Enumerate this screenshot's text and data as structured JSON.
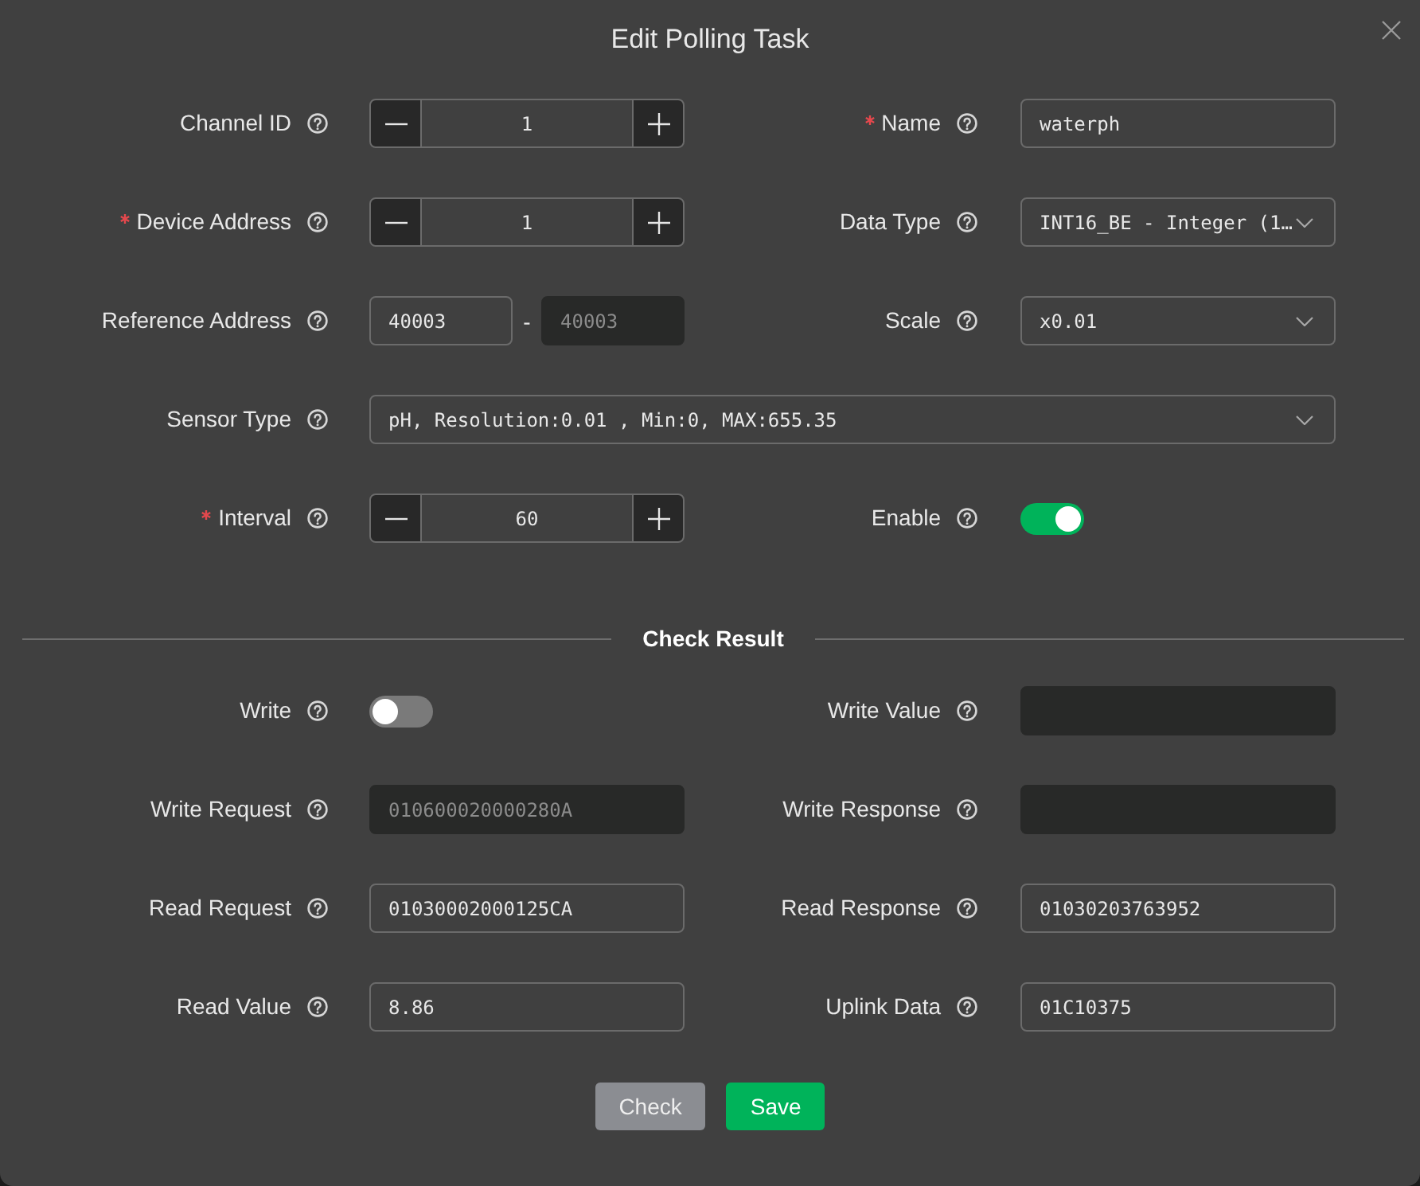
{
  "dialog": {
    "title": "Edit Polling Task"
  },
  "form": {
    "rows": [
      {
        "fields": [
          {
            "kind": "stepper",
            "label": "Channel ID",
            "required": false,
            "value": "1"
          },
          {
            "kind": "text",
            "label": "Name",
            "required": true,
            "value": "waterph",
            "disabled": false
          }
        ]
      },
      {
        "fields": [
          {
            "kind": "stepper",
            "label": "Device Address",
            "required": true,
            "value": "1"
          },
          {
            "kind": "select",
            "label": "Data Type",
            "required": false,
            "value": "INT16_BE - Integer (1…"
          }
        ]
      },
      {
        "fields": [
          {
            "kind": "range",
            "label": "Reference Address",
            "required": false,
            "from": {
              "value": "40003",
              "disabled": false
            },
            "separator": "-",
            "to": {
              "value": "40003",
              "disabled": true
            }
          },
          {
            "kind": "select",
            "label": "Scale",
            "required": false,
            "value": "x0.01"
          }
        ]
      },
      {
        "fields": [
          {
            "kind": "select",
            "label": "Sensor Type",
            "required": false,
            "value": "pH, Resolution:0.01 , Min:0, MAX:655.35"
          }
        ]
      },
      {
        "fields": [
          {
            "kind": "stepper",
            "label": "Interval",
            "required": true,
            "value": "60"
          },
          {
            "kind": "toggle",
            "label": "Enable",
            "required": false,
            "on": true
          }
        ]
      }
    ]
  },
  "check_result": {
    "title": "Check Result",
    "rows": [
      {
        "fields": [
          {
            "kind": "toggle",
            "label": "Write",
            "required": false,
            "on": false
          },
          {
            "kind": "text",
            "label": "Write Value",
            "required": false,
            "disabled": true
          }
        ]
      },
      {
        "fields": [
          {
            "kind": "text",
            "label": "Write Request",
            "required": false,
            "value": "010600020000280A",
            "disabled": true
          },
          {
            "kind": "text",
            "label": "Write Response",
            "required": false,
            "disabled": true
          }
        ]
      },
      {
        "fields": [
          {
            "kind": "text",
            "label": "Read Request",
            "required": false,
            "value": "01030002000125CA",
            "disabled": false
          },
          {
            "kind": "text",
            "label": "Read Response",
            "required": false,
            "value": "01030203763952",
            "disabled": false
          }
        ]
      },
      {
        "fields": [
          {
            "kind": "text",
            "label": "Read Value",
            "required": false,
            "value": "8.86",
            "disabled": false
          },
          {
            "kind": "text",
            "label": "Uplink Data",
            "required": false,
            "value": "01C10375",
            "disabled": false
          }
        ]
      }
    ]
  },
  "buttons": [
    {
      "label": "Check",
      "kind": "secondary"
    },
    {
      "label": "Save",
      "kind": "primary"
    }
  ]
}
